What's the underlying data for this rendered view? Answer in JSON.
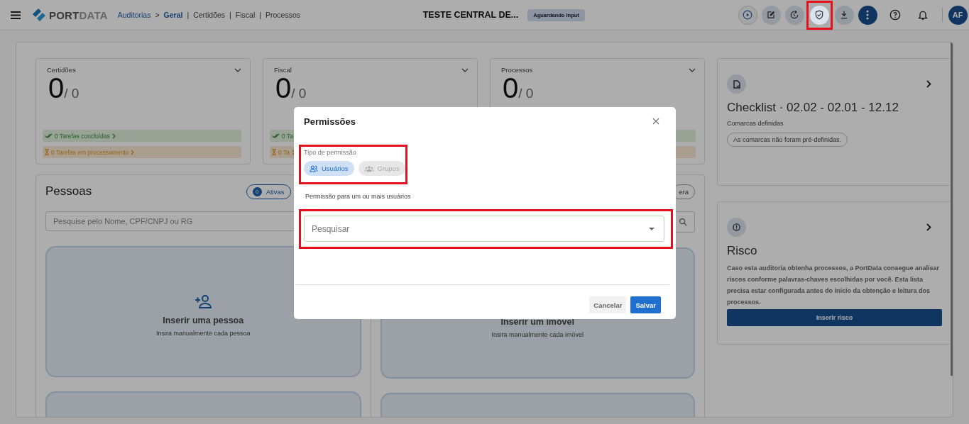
{
  "topbar": {
    "brand_strong": "PORT",
    "brand_light": "DATA",
    "breadcrumbs": [
      {
        "label": "Auditorias",
        "separator": ">",
        "selected": false
      },
      {
        "label": "Geral",
        "separator": "|",
        "selected": true
      },
      {
        "label": "Certidões",
        "separator": "|",
        "selected": false
      },
      {
        "label": "Fiscal",
        "separator": "|",
        "selected": false
      },
      {
        "label": "Processos",
        "selected": false
      }
    ],
    "title": "TESTE CENTRAL DE...",
    "status": "Aguardando Input",
    "actions": [
      {
        "kind": "play",
        "highlighted": false
      },
      {
        "kind": "edit",
        "highlighted": false
      },
      {
        "kind": "history",
        "highlighted": false
      },
      {
        "kind": "shield",
        "highlighted": true
      },
      {
        "kind": "download",
        "highlighted": false
      },
      {
        "kind": "more",
        "highlighted": false
      },
      {
        "kind": "help",
        "highlighted": false
      },
      {
        "kind": "bell",
        "highlighted": false
      }
    ],
    "avatar": "AF"
  },
  "stats": [
    {
      "title": "Certidões",
      "value": "0",
      "total": "/ 0",
      "tasks": [
        {
          "kind": "done",
          "label": "0 Tarefas concluídas"
        },
        {
          "kind": "pending",
          "label": "0 Tarefas em processamento"
        }
      ]
    },
    {
      "title": "Fiscal",
      "value": "0",
      "total": "/ 0",
      "tasks": [
        {
          "kind": "done",
          "label": "0 Ta"
        },
        {
          "kind": "pending",
          "label": "0 Ta"
        }
      ]
    },
    {
      "title": "Processos",
      "value": "0",
      "total": "/ 0",
      "tasks": [
        {
          "kind": "done"
        },
        {
          "kind": "pending"
        }
      ]
    }
  ],
  "people": {
    "title": "Pessoas",
    "chips": [
      {
        "count": "0",
        "label": "Ativas"
      }
    ],
    "search": {
      "placeholder": "Pesquise pelo Nome, CPF/CNPJ ou RG"
    },
    "action": {
      "title": "Inserir uma pessoa",
      "subtitle": "Insira manualmente cada pessoa"
    }
  },
  "properties": {
    "chip": "era",
    "action": {
      "title": "Inserir um imóvel",
      "subtitle": "Insira manualmente cada imóvel"
    }
  },
  "checklist": {
    "title": "Checklist · 02.02 - 02.01 - 12.12",
    "label": "Comarcas definidas",
    "chip": "As comarcas não foram pré-definidas."
  },
  "risk": {
    "title": "Risco",
    "description": "Caso esta auditoria obtenha processos, a PortData consegue analisar riscos conforme palavras-chaves escolhidas por você. Esta lista precisa estar configurada antes do início da obtenção e leitura dos processos.",
    "button": "Inserir risco"
  },
  "dialog": {
    "title": "Permissões",
    "type_label": "Tipo de permissão",
    "type_highlighted": true,
    "options": [
      {
        "kind": "users",
        "label": "Usuários",
        "selected": true
      },
      {
        "kind": "groups",
        "label": "Grupos",
        "selected": false
      }
    ],
    "field_label": "Permissão para um ou mais usuários",
    "search": {
      "placeholder": "Pesquisar",
      "highlighted": true
    },
    "cancel": "Cancelar",
    "save": "Salvar"
  }
}
